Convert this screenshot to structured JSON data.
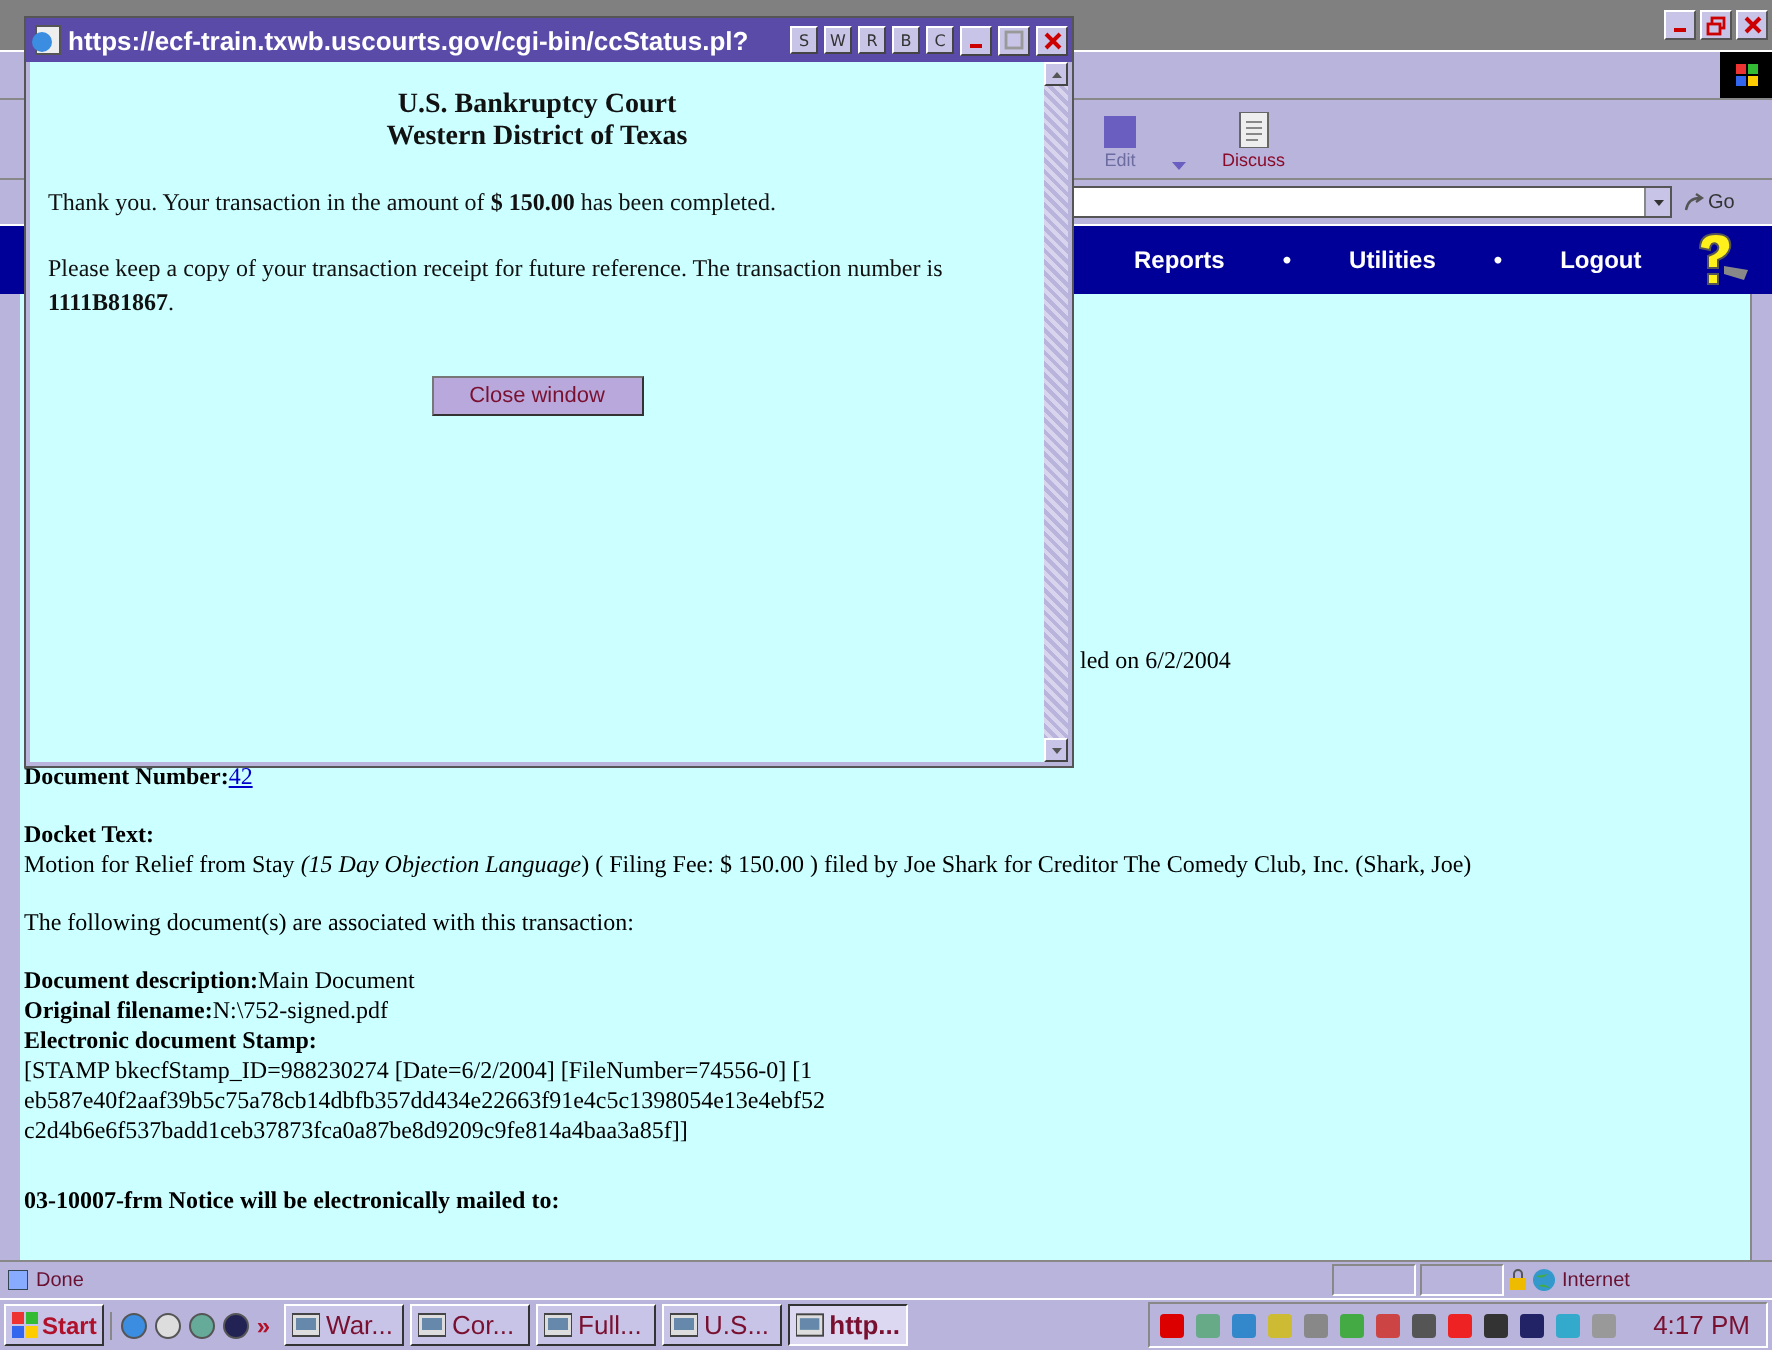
{
  "browser": {
    "toolbar": [
      {
        "label": "Edit"
      },
      {
        "label": "Discuss"
      }
    ],
    "address_bar": {
      "go_label": "Go"
    },
    "nav": {
      "items": [
        "Reports",
        "Utilities",
        "Logout"
      ],
      "separators": [
        "•",
        "•"
      ]
    }
  },
  "content": {
    "filed_fragment": "led on 6/2/2004",
    "document_number": {
      "label": "Document Number:",
      "link": "42"
    },
    "docket_text": {
      "label": "Docket Text:",
      "text": "Motion for Relief from Stay *(15 Day Objection Language*) ( Filing Fee: $ 150.00 ) filed by Joe Shark for Creditor The Comedy Club, Inc. (Shark, Joe)"
    },
    "intro": "The following document(s) are associated with this transaction:",
    "fields": [
      {
        "label": "Document description:",
        "value": "Main Document"
      },
      {
        "label": "Original filename:",
        "value": "N:\\752-signed.pdf"
      }
    ],
    "stamp": {
      "label": "Electronic document Stamp:",
      "lines": [
        "[STAMP bkecfStamp_ID=988230274 [Date=6/2/2004] [FileNumber=74556-0] [1",
        "eb587e40f2aaf39b5c75a78cb14dbfb357dd434e22663f91e4c5c1398054e13e4ebf52",
        "c2d4b6e6f537badd1ceb37873fca0a87be8d9209c9fe814a4baa3a85f]]"
      ]
    },
    "notice": "03-10007-frm Notice will be electronically mailed to:"
  },
  "status_bar": {
    "text": "Done",
    "zone": "Internet"
  },
  "popup": {
    "title": "https://ecf-train.txwb.uscourts.gov/cgi-bin/ccStatus.pl?",
    "title_buttons": [
      "S",
      "W",
      "R",
      "B",
      "C"
    ],
    "heading": [
      "U.S. Bankruptcy Court",
      "Western District of Texas"
    ],
    "paragraphs": [
      "Thank you. Your transaction in the amount of **$ 150.00** has been completed.",
      "Please keep a copy of your transaction receipt for future reference. The transaction number is **1111B81867**."
    ],
    "button": "Close window"
  },
  "taskbar": {
    "start": "Start",
    "chevron": "»",
    "tasks": [
      {
        "label": "War...",
        "selected": false
      },
      {
        "label": "Cor...",
        "selected": false
      },
      {
        "label": "Full...",
        "selected": false
      },
      {
        "label": "U.S...",
        "selected": false
      },
      {
        "label": "http...",
        "selected": true
      }
    ],
    "clock": "4:17 PM"
  }
}
